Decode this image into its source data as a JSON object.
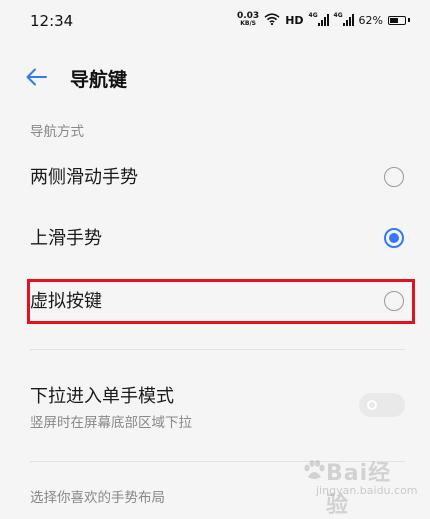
{
  "status_bar": {
    "time": "12:34",
    "net_speed_value": "0.03",
    "net_speed_unit": "KB/S",
    "hd_label": "HD",
    "sim1_label": "4G",
    "sim2_label": "4G",
    "battery": "62%",
    "battery_level": 0.62
  },
  "header": {
    "title": "导航键"
  },
  "navigation_section": {
    "label": "导航方式",
    "options": [
      {
        "label": "两侧滑动手势",
        "selected": false
      },
      {
        "label": "上滑手势",
        "selected": true
      },
      {
        "label": "虚拟按键",
        "selected": false
      }
    ]
  },
  "one_hand_mode": {
    "title": "下拉进入单手模式",
    "subtitle": "竖屏时在屏幕底部区域下拉",
    "enabled": false
  },
  "layout_section": {
    "label": "选择你喜欢的手势布局"
  },
  "watermark": {
    "text": "Bai经验",
    "url": "jingyan.baidu.com"
  },
  "colors": {
    "accent": "#3478f6",
    "highlight": "#e60f1f",
    "background": "#f5f5f5"
  }
}
